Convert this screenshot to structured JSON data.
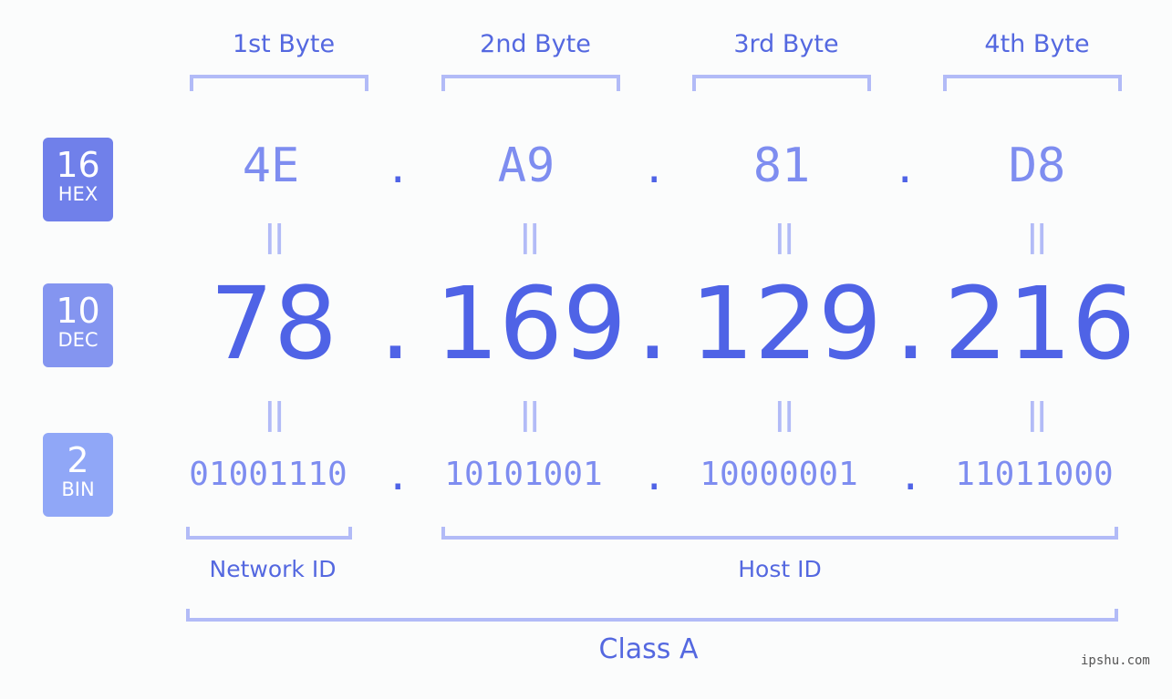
{
  "bytes": [
    {
      "label": "1st Byte",
      "hex": "4E",
      "dec": "78",
      "bin": "01001110"
    },
    {
      "label": "2nd Byte",
      "hex": "A9",
      "dec": "169",
      "bin": "10101001"
    },
    {
      "label": "3rd Byte",
      "hex": "81",
      "dec": "129",
      "bin": "10000001"
    },
    {
      "label": "4th Byte",
      "hex": "D8",
      "dec": "216",
      "bin": "11011000"
    }
  ],
  "badges": {
    "hex": {
      "num": "16",
      "label": "HEX",
      "color": "#7080ea"
    },
    "dec": {
      "num": "10",
      "label": "DEC",
      "color": "#8495f0"
    },
    "bin": {
      "num": "2",
      "label": "BIN",
      "color": "#90a7f7"
    }
  },
  "separator": ".",
  "equals": "||",
  "network_id": "Network ID",
  "host_id": "Host ID",
  "class_label": "Class A",
  "watermark": "ipshu.com"
}
